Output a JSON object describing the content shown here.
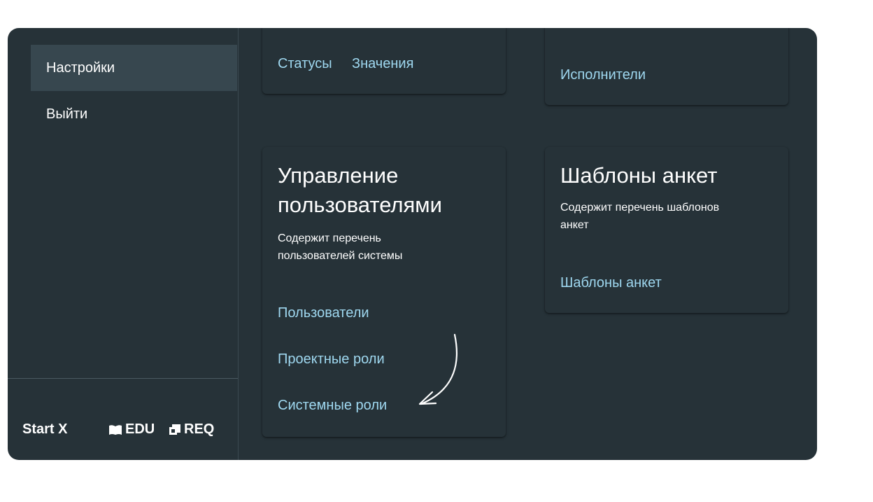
{
  "sidebar": {
    "items": [
      {
        "label": "Настройки",
        "active": true
      },
      {
        "label": "Выйти",
        "active": false
      }
    ],
    "brands": {
      "startx": "Start X",
      "edu": "EDU",
      "req": "REQ"
    }
  },
  "cards": {
    "top_left": {
      "links": [
        "Статусы",
        "Значения"
      ]
    },
    "top_right": {
      "links": [
        "Исполнители"
      ]
    },
    "users": {
      "title_line1": "Управление",
      "title_line2": "пользователями",
      "desc_line1": "Содержит перечень",
      "desc_line2": "пользователей системы",
      "links": [
        "Пользователи",
        "Проектные роли",
        "Системные роли"
      ]
    },
    "templates": {
      "title": "Шаблоны анкет",
      "desc_line1": "Содержит перечень шаблонов",
      "desc_line2": "анкет",
      "links": [
        "Шаблоны анкет"
      ]
    }
  },
  "colors": {
    "background": "#263238",
    "sidebar_active": "#37474f",
    "link": "#9fd8f0",
    "text": "#ffffff"
  }
}
